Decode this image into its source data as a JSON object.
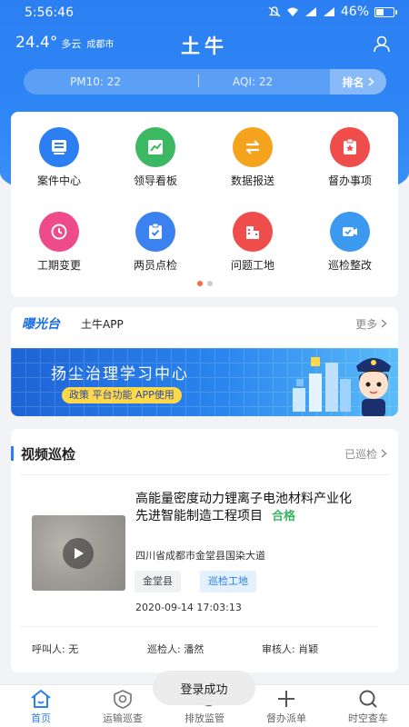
{
  "status_bar": {
    "time": "5:56:46",
    "battery": "46%",
    "battery_level": 0.46
  },
  "header": {
    "temperature": "24.4°",
    "weather": "多云",
    "city": "成都市",
    "title": "土牛",
    "pm10": "PM10:  22",
    "aqi": "AQI:  22",
    "rank_label": "排名"
  },
  "menu": {
    "items": [
      {
        "label": "案件中心",
        "icon": "case-center-icon",
        "color": "#2b7ff2"
      },
      {
        "label": "领导看板",
        "icon": "leader-board-icon",
        "color": "#3cb862"
      },
      {
        "label": "数据报送",
        "icon": "data-report-icon",
        "color": "#f5a21c"
      },
      {
        "label": "督办事项",
        "icon": "supervise-icon",
        "color": "#ef4c4c"
      },
      {
        "label": "工期变更",
        "icon": "schedule-change-icon",
        "color": "#ee4b8a"
      },
      {
        "label": "两员点检",
        "icon": "inspection-check-icon",
        "color": "#3b82f0"
      },
      {
        "label": "问题工地",
        "icon": "problem-site-icon",
        "color": "#ef4c4c"
      },
      {
        "label": "巡检整改",
        "icon": "patrol-rectify-icon",
        "color": "#3b9af0"
      }
    ],
    "page_dots": 2,
    "active_dot": 0
  },
  "exposure": {
    "logo": "曝光台",
    "subtitle": "土牛APP",
    "more": "更多",
    "banner_title": "扬尘治理学习中心",
    "banner_tags": "政策  平台功能  APP使用"
  },
  "video": {
    "title": "视频巡检",
    "link": "已巡检",
    "project_name": "高能量密度动力锂离子电池材料产业化先进智能制造工程项目",
    "status": "合格",
    "address": "四川省成都市金堂县国染大道",
    "tags": [
      "金堂县",
      "巡检工地"
    ],
    "time": "2020-09-14 17:03:13",
    "caller": "呼叫人:  无",
    "inspector": "巡检人:  潘然",
    "reviewer": "审核人:  肖颖"
  },
  "toast": "登录成功",
  "nav": [
    {
      "label": "首页",
      "icon": "home-icon",
      "active": true
    },
    {
      "label": "运输巡查",
      "icon": "transport-patrol-icon",
      "active": false
    },
    {
      "label": "排放监管",
      "icon": "emission-icon",
      "active": false
    },
    {
      "label": "督办派单",
      "icon": "plus-icon",
      "active": false
    },
    {
      "label": "时空查车",
      "icon": "search-car-icon",
      "active": false
    }
  ]
}
